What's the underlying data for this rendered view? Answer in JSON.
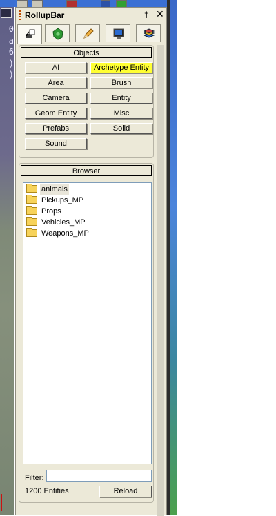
{
  "viewport": {
    "readout": [
      "0",
      "a",
      "6",
      ")",
      ")"
    ]
  },
  "rollup": {
    "title": "RollupBar",
    "pin_glyph": "†",
    "close_glyph": "✕",
    "tabs": [
      {
        "name": "objects-tab",
        "icon": "create-objects-icon",
        "active": true
      },
      {
        "name": "terrain-tab",
        "icon": "terrain-icon",
        "active": false
      },
      {
        "name": "modify-tab",
        "icon": "pencil-icon",
        "active": false
      },
      {
        "name": "display-tab",
        "icon": "monitor-icon",
        "active": false
      },
      {
        "name": "layers-tab",
        "icon": "layers-icon",
        "active": false
      }
    ],
    "objects": {
      "header": "Objects",
      "buttons": [
        "AI",
        "Archetype Entity",
        "Area",
        "Brush",
        "Camera",
        "Entity",
        "Geom Entity",
        "Misc",
        "Prefabs",
        "Solid",
        "Sound"
      ],
      "highlighted": "Archetype Entity"
    },
    "browser": {
      "header": "Browser",
      "items": [
        "animals",
        "Pickups_MP",
        "Props",
        "Vehicles_MP",
        "Weapons_MP"
      ],
      "filter_label": "Filter:",
      "filter_value": "",
      "entity_count": "1200 Entities",
      "reload_label": "Reload"
    }
  },
  "colors": {
    "panel_bg": "#ece9d8",
    "highlight": "#ffff33",
    "titlebar_accent": "#c04a00"
  }
}
